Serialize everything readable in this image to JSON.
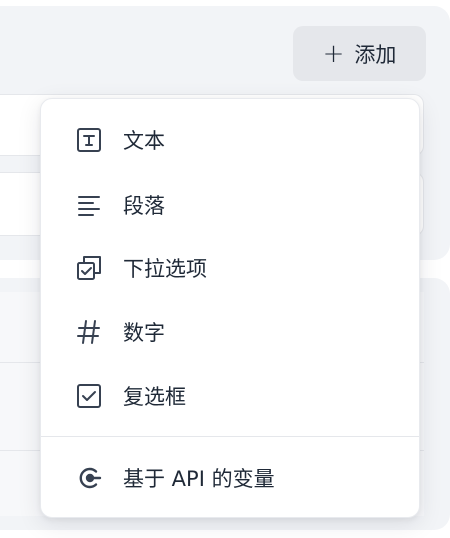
{
  "toolbar": {
    "add_label": "添加"
  },
  "menu": {
    "items": [
      {
        "label": "文本",
        "icon": "text-box-icon"
      },
      {
        "label": "段落",
        "icon": "paragraph-lines-icon"
      },
      {
        "label": "下拉选项",
        "icon": "select-stack-icon"
      },
      {
        "label": "数字",
        "icon": "hash-icon"
      },
      {
        "label": "复选框",
        "icon": "checkbox-icon"
      }
    ],
    "api_item": {
      "label": "基于 API 的变量",
      "icon": "api-icon"
    }
  },
  "colors": {
    "panel_bg": "#f2f4f7",
    "button_bg": "#e5e7eb",
    "text": "#1f2937",
    "icon": "#374151"
  }
}
